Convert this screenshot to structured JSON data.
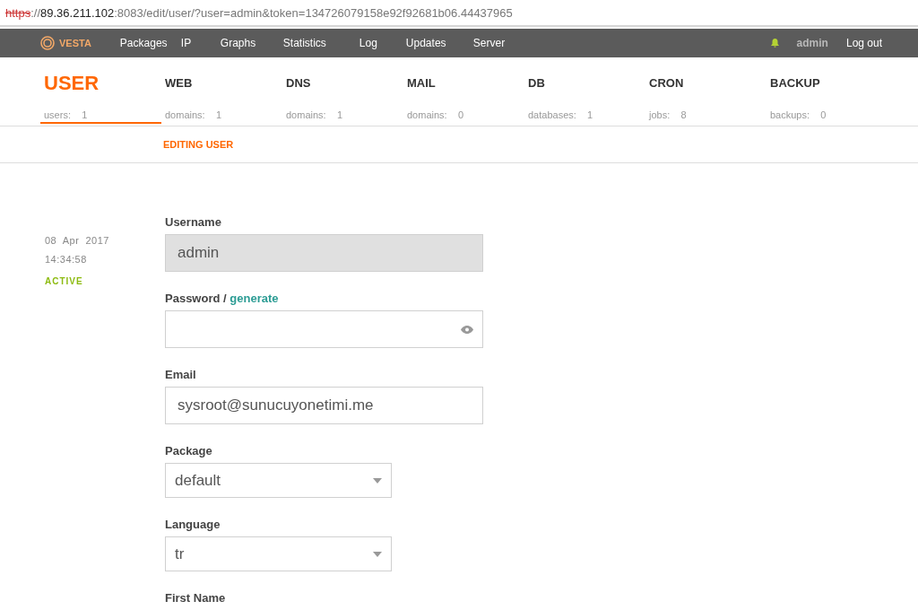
{
  "address_bar": {
    "scheme": "https",
    "separator": "://",
    "host": "89.36.211.102",
    "path": ":8083/edit/user/?user=admin&token=134726079158e92f92681b06.44437965",
    "insecure": true
  },
  "top_nav": {
    "logo": "VESTA",
    "items": [
      "Packages",
      "IP",
      "Graphs",
      "Statistics",
      "Log",
      "Updates",
      "Server"
    ],
    "user": "admin",
    "logout": "Log out"
  },
  "sections": [
    {
      "title": "USER",
      "stat_label": "users:",
      "stat_value": "1",
      "selected": true
    },
    {
      "title": "WEB",
      "stat_label": "domains:",
      "stat_value": "1",
      "selected": false
    },
    {
      "title": "DNS",
      "stat_label": "domains:",
      "stat_value": "1",
      "selected": false
    },
    {
      "title": "MAIL",
      "stat_label": "domains:",
      "stat_value": "0",
      "selected": false
    },
    {
      "title": "DB",
      "stat_label": "databases:",
      "stat_value": "1",
      "selected": false
    },
    {
      "title": "CRON",
      "stat_label": "jobs:",
      "stat_value": "8",
      "selected": false
    },
    {
      "title": "BACKUP",
      "stat_label": "backups:",
      "stat_value": "0",
      "selected": false
    }
  ],
  "subtitle": "EDITING USER",
  "record": {
    "date": "08  Apr  2017",
    "time": "14:34:58",
    "status": "ACTIVE"
  },
  "form": [
    {
      "kind": "text",
      "label": "Username",
      "value": "admin",
      "disabled": true
    },
    {
      "kind": "password",
      "label": "Password",
      "link_separator": "/",
      "link": "generate"
    },
    {
      "kind": "text",
      "label": "Email",
      "value": "sysroot@sunucuyonetimi.me",
      "disabled": false
    },
    {
      "kind": "select",
      "label": "Package",
      "value": "default"
    },
    {
      "kind": "select",
      "label": "Language",
      "value": "tr"
    },
    {
      "kind": "text",
      "label": "First Name"
    }
  ]
}
